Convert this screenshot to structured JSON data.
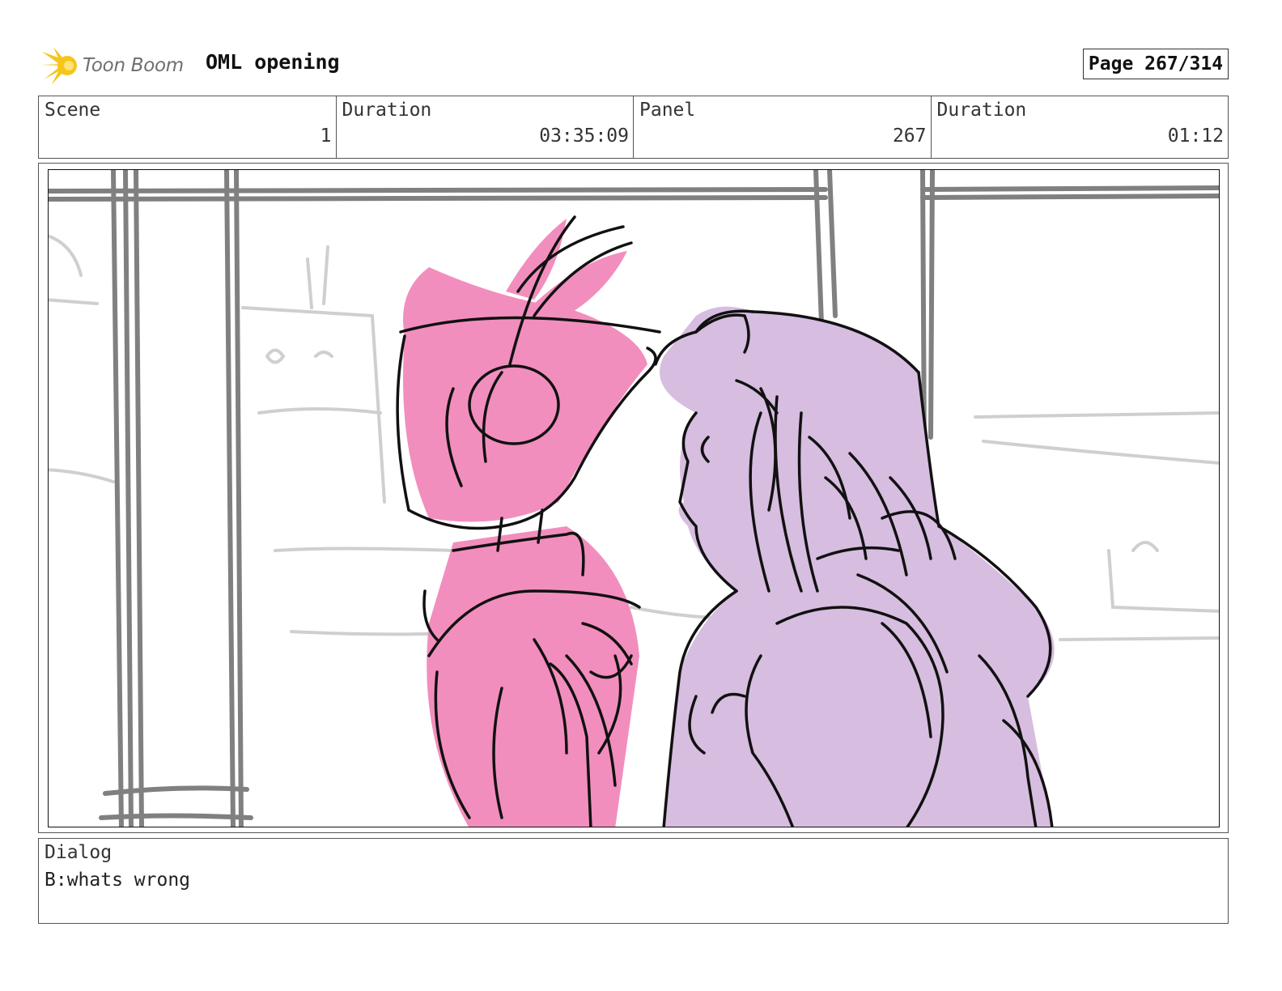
{
  "header": {
    "logo_text": "Toon Boom",
    "title": "OML opening",
    "page_label": "Page 267/314"
  },
  "info": [
    {
      "label": "Scene",
      "value": "1"
    },
    {
      "label": "Duration",
      "value": "03:35:09"
    },
    {
      "label": "Panel",
      "value": "267"
    },
    {
      "label": "Duration",
      "value": "01:12"
    }
  ],
  "dialog": {
    "label": "Dialog",
    "text": "B:whats wrong"
  },
  "colors": {
    "robot_fill": "#f28ebd",
    "girl_fill": "#d7bde0",
    "pillar_gray": "#808080",
    "logo_yellow": "#f5c518"
  }
}
